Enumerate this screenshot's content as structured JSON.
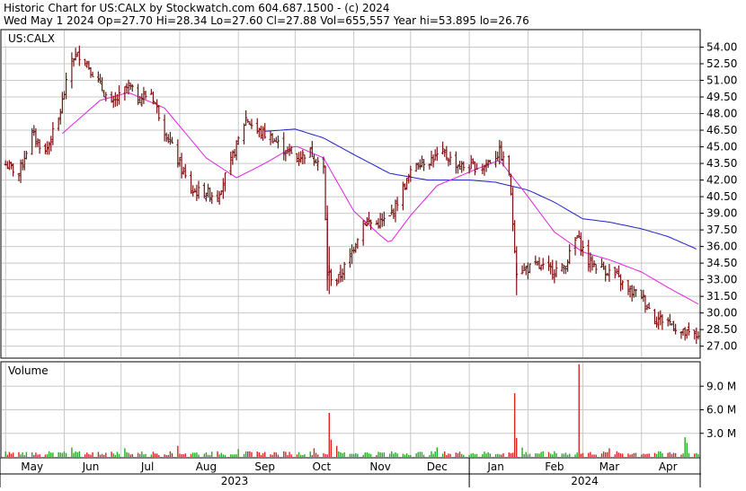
{
  "header": {
    "line1": "Historic Chart for US:CALX by Stockwatch.com 604.687.1500 - (c) 2024",
    "line2": "Wed May  1 2024  Op=27.70  Hi=28.34  Lo=27.60  Cl=27.88  Vol=655,557  Year hi=53.895  lo=26.76"
  },
  "symbol_label": "US:CALX",
  "volume_label": "Volume",
  "colors": {
    "background": "#ffffff",
    "grid": "#c8c8c8",
    "border": "#000000",
    "price_bar": "#7a1010",
    "ma_short": "#e020e0",
    "ma_long": "#2020c8",
    "volume_up": "#22aa22",
    "volume_down": "#dd2222"
  },
  "chart_data": [
    {
      "type": "ohlc",
      "title": "US:CALX",
      "ylim": [
        26.0,
        55.5
      ],
      "y_ticks": [
        "54.00",
        "52.50",
        "51.00",
        "49.50",
        "48.00",
        "46.50",
        "45.00",
        "43.50",
        "42.00",
        "40.50",
        "39.00",
        "37.50",
        "36.00",
        "34.50",
        "33.00",
        "31.50",
        "30.00",
        "28.50",
        "27.00"
      ],
      "x_ticks": [
        "May",
        "Jun",
        "Jul",
        "Aug",
        "Sep",
        "Oct",
        "Nov",
        "Dec",
        "Jan",
        "Feb",
        "Mar",
        "Apr"
      ],
      "year_labels": [
        "2023",
        "2024"
      ],
      "price_anchors": [
        {
          "d": "2023-05-01",
          "p": 43.4
        },
        {
          "d": "2023-05-08",
          "p": 42.6
        },
        {
          "d": "2023-05-15",
          "p": 46.2
        },
        {
          "d": "2023-05-22",
          "p": 44.5
        },
        {
          "d": "2023-05-29",
          "p": 47.5
        },
        {
          "d": "2023-06-05",
          "p": 53.0
        },
        {
          "d": "2023-06-10",
          "p": 53.4
        },
        {
          "d": "2023-06-19",
          "p": 50.8
        },
        {
          "d": "2023-06-26",
          "p": 48.7
        },
        {
          "d": "2023-07-05",
          "p": 50.5
        },
        {
          "d": "2023-07-10",
          "p": 49.3
        },
        {
          "d": "2023-07-17",
          "p": 49.9
        },
        {
          "d": "2023-07-24",
          "p": 46.5
        },
        {
          "d": "2023-07-31",
          "p": 43.8
        },
        {
          "d": "2023-08-07",
          "p": 41.0
        },
        {
          "d": "2023-08-14",
          "p": 40.9
        },
        {
          "d": "2023-08-21",
          "p": 40.6
        },
        {
          "d": "2023-08-28",
          "p": 43.6
        },
        {
          "d": "2023-09-05",
          "p": 47.6
        },
        {
          "d": "2023-09-11",
          "p": 46.4
        },
        {
          "d": "2023-09-18",
          "p": 45.9
        },
        {
          "d": "2023-09-25",
          "p": 44.8
        },
        {
          "d": "2023-10-02",
          "p": 44.0
        },
        {
          "d": "2023-10-09",
          "p": 44.6
        },
        {
          "d": "2023-10-16",
          "p": 43.0
        },
        {
          "d": "2023-10-18",
          "p": 33.6
        },
        {
          "d": "2023-10-23",
          "p": 32.8
        },
        {
          "d": "2023-10-30",
          "p": 35.1
        },
        {
          "d": "2023-11-06",
          "p": 38.3
        },
        {
          "d": "2023-11-13",
          "p": 38.0
        },
        {
          "d": "2023-11-20",
          "p": 38.6
        },
        {
          "d": "2023-11-27",
          "p": 41.2
        },
        {
          "d": "2023-12-04",
          "p": 43.6
        },
        {
          "d": "2023-12-11",
          "p": 43.8
        },
        {
          "d": "2023-12-18",
          "p": 44.4
        },
        {
          "d": "2023-12-27",
          "p": 43.2
        },
        {
          "d": "2024-01-08",
          "p": 43.2
        },
        {
          "d": "2024-01-17",
          "p": 44.5
        },
        {
          "d": "2024-01-22",
          "p": 42.6
        },
        {
          "d": "2024-01-26",
          "p": 33.8
        },
        {
          "d": "2024-02-05",
          "p": 34.2
        },
        {
          "d": "2024-02-14",
          "p": 33.9
        },
        {
          "d": "2024-02-20",
          "p": 34.0
        },
        {
          "d": "2024-02-27",
          "p": 36.9
        },
        {
          "d": "2024-03-04",
          "p": 34.6
        },
        {
          "d": "2024-03-11",
          "p": 34.1
        },
        {
          "d": "2024-03-18",
          "p": 33.4
        },
        {
          "d": "2024-03-25",
          "p": 32.0
        },
        {
          "d": "2024-04-01",
          "p": 31.6
        },
        {
          "d": "2024-04-08",
          "p": 29.5
        },
        {
          "d": "2024-04-15",
          "p": 29.3
        },
        {
          "d": "2024-04-22",
          "p": 28.2
        },
        {
          "d": "2024-05-01",
          "p": 27.88
        }
      ],
      "ma_short_anchors": [
        {
          "d": "2023-05-31",
          "p": 46.2
        },
        {
          "d": "2023-06-20",
          "p": 49.2
        },
        {
          "d": "2023-07-05",
          "p": 49.9
        },
        {
          "d": "2023-07-24",
          "p": 48.5
        },
        {
          "d": "2023-08-15",
          "p": 44.0
        },
        {
          "d": "2023-08-31",
          "p": 42.2
        },
        {
          "d": "2023-09-15",
          "p": 43.5
        },
        {
          "d": "2023-10-01",
          "p": 45.1
        },
        {
          "d": "2023-10-16",
          "p": 44.0
        },
        {
          "d": "2023-11-01",
          "p": 39.2
        },
        {
          "d": "2023-11-15",
          "p": 37.0
        },
        {
          "d": "2023-11-20",
          "p": 36.3
        },
        {
          "d": "2023-12-01",
          "p": 38.8
        },
        {
          "d": "2023-12-15",
          "p": 41.5
        },
        {
          "d": "2024-01-05",
          "p": 43.0
        },
        {
          "d": "2024-01-17",
          "p": 43.8
        },
        {
          "d": "2024-02-01",
          "p": 40.5
        },
        {
          "d": "2024-02-15",
          "p": 37.3
        },
        {
          "d": "2024-03-01",
          "p": 35.5
        },
        {
          "d": "2024-03-15",
          "p": 34.8
        },
        {
          "d": "2024-04-01",
          "p": 33.7
        },
        {
          "d": "2024-04-15",
          "p": 32.3
        },
        {
          "d": "2024-05-01",
          "p": 30.8
        }
      ],
      "ma_long_anchors": [
        {
          "d": "2023-09-15",
          "p": 46.4
        },
        {
          "d": "2023-10-01",
          "p": 46.6
        },
        {
          "d": "2023-10-16",
          "p": 45.8
        },
        {
          "d": "2023-11-01",
          "p": 44.3
        },
        {
          "d": "2023-11-20",
          "p": 42.6
        },
        {
          "d": "2023-12-10",
          "p": 42.0
        },
        {
          "d": "2024-01-01",
          "p": 42.0
        },
        {
          "d": "2024-01-15",
          "p": 41.8
        },
        {
          "d": "2024-02-01",
          "p": 41.1
        },
        {
          "d": "2024-02-15",
          "p": 40.0
        },
        {
          "d": "2024-03-01",
          "p": 38.5
        },
        {
          "d": "2024-03-15",
          "p": 38.2
        },
        {
          "d": "2024-04-01",
          "p": 37.6
        },
        {
          "d": "2024-04-15",
          "p": 36.9
        },
        {
          "d": "2024-05-01",
          "p": 35.7
        }
      ]
    },
    {
      "type": "bar",
      "title": "Volume",
      "ylim": [
        0,
        12000000
      ],
      "y_ticks": [
        "9.0 M",
        "6.0 M",
        "3.0 M"
      ],
      "base_volume": 450000,
      "volume_spikes": [
        {
          "d": "2023-06-05",
          "v": 1200000
        },
        {
          "d": "2023-07-03",
          "v": 1100000
        },
        {
          "d": "2023-07-31",
          "v": 1400000
        },
        {
          "d": "2023-09-01",
          "v": 1000000
        },
        {
          "d": "2023-10-11",
          "v": 1100000
        },
        {
          "d": "2023-10-19",
          "v": 5600000
        },
        {
          "d": "2023-10-20",
          "v": 2200000
        },
        {
          "d": "2023-10-23",
          "v": 1400000
        },
        {
          "d": "2023-12-15",
          "v": 1200000
        },
        {
          "d": "2024-01-25",
          "v": 8100000
        },
        {
          "d": "2024-01-26",
          "v": 2400000
        },
        {
          "d": "2024-01-29",
          "v": 1200000
        },
        {
          "d": "2024-02-28",
          "v": 11800000
        },
        {
          "d": "2024-03-15",
          "v": 1100000
        },
        {
          "d": "2024-04-24",
          "v": 2500000
        },
        {
          "d": "2024-04-25",
          "v": 1800000
        }
      ]
    }
  ]
}
